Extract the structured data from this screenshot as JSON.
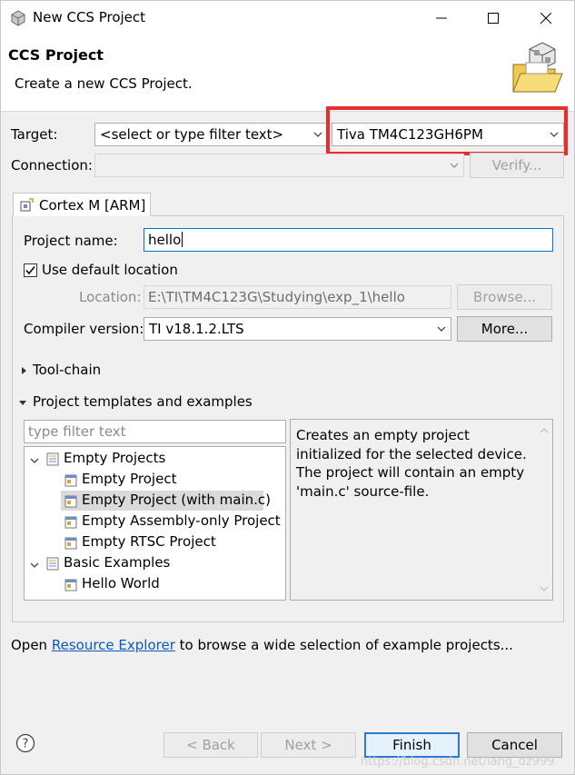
{
  "window": {
    "title": "New CCS Project"
  },
  "header": {
    "title": "CCS Project",
    "description": "Create a new CCS Project."
  },
  "target": {
    "label": "Target:",
    "filter_placeholder": "<select or type filter text>",
    "device": "Tiva TM4C123GH6PM"
  },
  "connection": {
    "label": "Connection:",
    "value": "",
    "verify_label": "Verify..."
  },
  "tab": {
    "label": "Cortex M [ARM]"
  },
  "project": {
    "name_label": "Project name:",
    "name_value": "hello",
    "use_default_location_label": "Use default location",
    "use_default_location_checked": true,
    "location_label": "Location:",
    "location_value": "E:\\TI\\TM4C123G\\Studying\\exp_1\\hello",
    "browse_label": "Browse...",
    "compiler_label": "Compiler version:",
    "compiler_value": "TI v18.1.2.LTS",
    "more_label": "More..."
  },
  "sections": {
    "toolchain": "Tool-chain",
    "templates": "Project templates and examples"
  },
  "templates": {
    "filter_placeholder": "type filter text",
    "tree": [
      {
        "label": "Empty Projects",
        "level": 0,
        "expanded": true
      },
      {
        "label": "Empty Project",
        "level": 1
      },
      {
        "label": "Empty Project (with main.c)",
        "level": 1,
        "selected": true
      },
      {
        "label": "Empty Assembly-only Project",
        "level": 1
      },
      {
        "label": "Empty RTSC Project",
        "level": 1
      },
      {
        "label": "Basic Examples",
        "level": 0,
        "expanded": true
      },
      {
        "label": "Hello World",
        "level": 1
      }
    ],
    "description": "Creates an empty project initialized for the selected device. The project will contain an empty 'main.c' source-file."
  },
  "footer_note": {
    "prefix": "Open",
    "link": "Resource Explorer",
    "suffix": "to browse a wide selection of example projects..."
  },
  "buttons": {
    "back": "< Back",
    "next": "Next >",
    "finish": "Finish",
    "cancel": "Cancel"
  },
  "watermark": "https://blog.csdn.net/lang_dz999",
  "colors": {
    "highlight": "#ee2b2b",
    "link": "#0a58c2",
    "default_button": "#2b79d5"
  }
}
